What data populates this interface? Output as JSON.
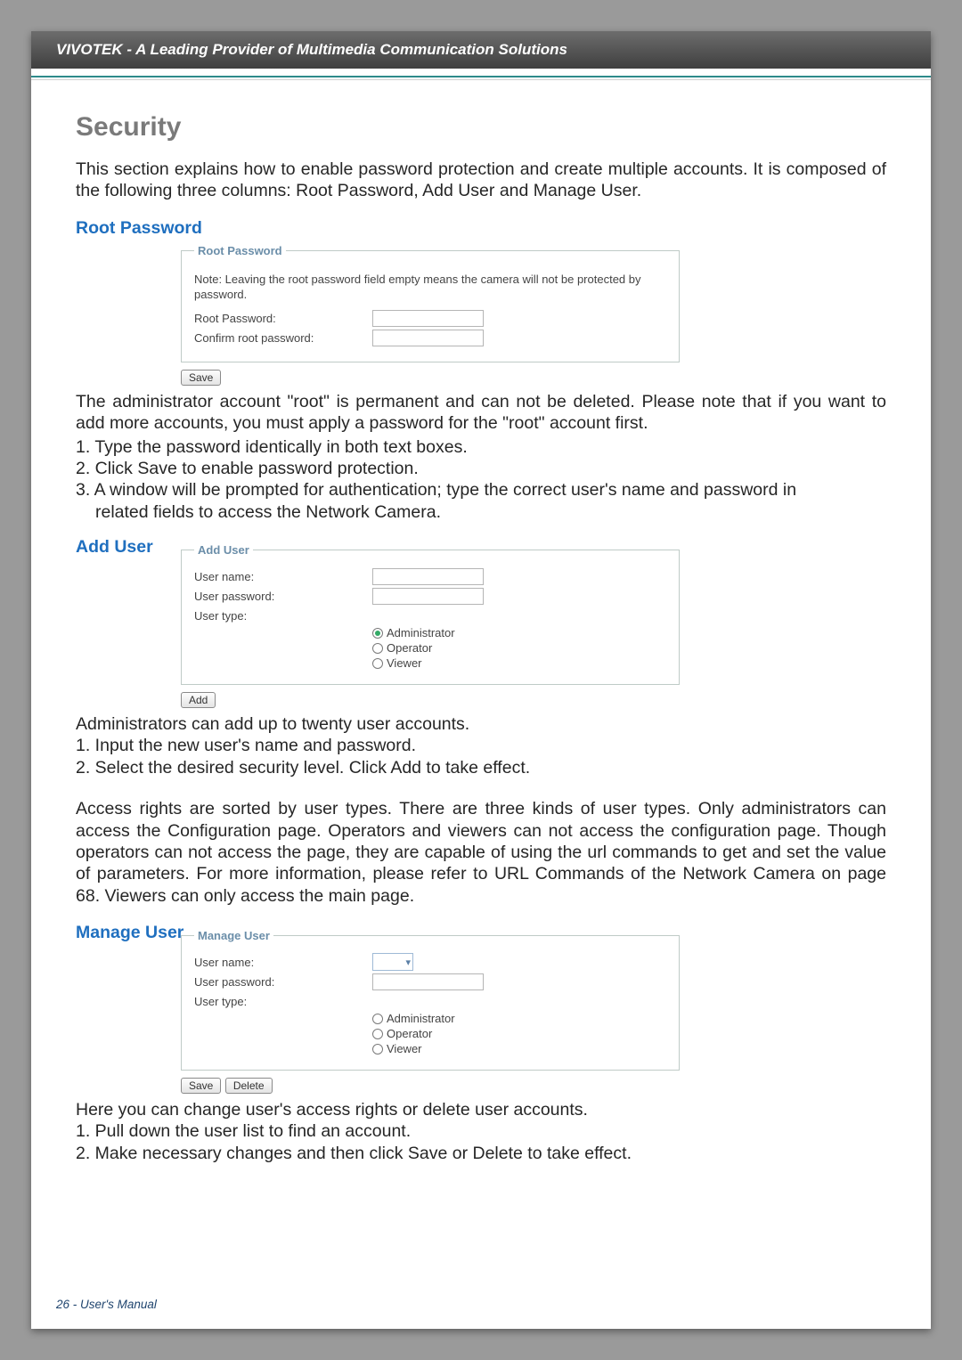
{
  "header": {
    "brand": "VIVOTEK - A Leading Provider of Multimedia Communication Solutions"
  },
  "title": "Security",
  "intro": "This section explains how to enable password protection and create multiple accounts. It is composed of the following three columns: Root Password, Add User and Manage User.",
  "root_password": {
    "heading": "Root Password",
    "legend": "Root Password",
    "note": "Note: Leaving the root password field empty means the camera will not be protected by password.",
    "field1": "Root Password:",
    "field2": "Confirm root password:",
    "save_btn": "Save",
    "after1": "The administrator account \"root\" is permanent and can not be deleted. Please note that if you want to add more accounts, you must apply a password for the \"root\" account first.",
    "step1": "1. Type the password identically in both text boxes.",
    "step2": "2. Click Save to enable password protection.",
    "step3a": "3. A window will be prompted for authentication; type the correct user's name and password in",
    "step3b": "related fields to access the Network Camera."
  },
  "add_user": {
    "heading": "Add User",
    "legend": "Add User",
    "uname": "User name:",
    "upass": "User password:",
    "utype": "User type:",
    "r_admin": "Administrator",
    "r_op": "Operator",
    "r_view": "Viewer",
    "add_btn": "Add",
    "after1": "Administrators can add up to twenty user accounts.",
    "step1": "1. Input the new user's name and password.",
    "step2": "2. Select the desired security level. Click Add to take effect.",
    "para": "Access rights are sorted by user types. There are three kinds of user types. Only administrators can access the Configuration page. Operators and viewers can not access the configuration page. Though operators can not access the page, they are capable of using the url commands to get and set the value of parameters. For more information, please refer to URL Commands of the Network Camera on page 68. Viewers can only access the main page."
  },
  "manage_user": {
    "heading": "Manage User",
    "legend": "Manage User",
    "uname": "User name:",
    "upass": "User password:",
    "utype": "User type:",
    "r_admin": "Administrator",
    "r_op": "Operator",
    "r_view": "Viewer",
    "save_btn": "Save",
    "delete_btn": "Delete",
    "after1": "Here you can change user's access rights or delete user accounts.",
    "step1": "1. Pull down the user list to find an account.",
    "step2": "2. Make necessary changes and then click Save or Delete to take effect."
  },
  "footer": "26 - User's Manual"
}
